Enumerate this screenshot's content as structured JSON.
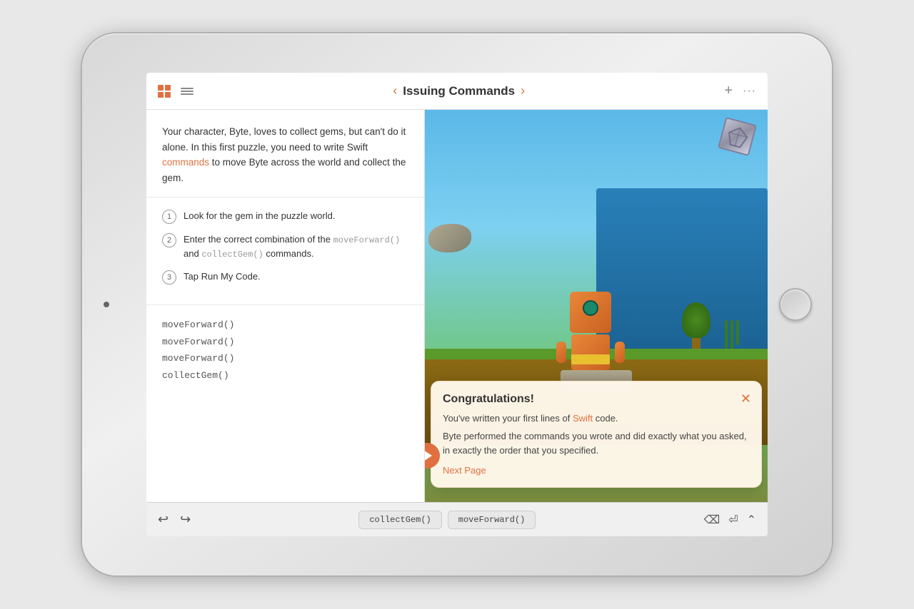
{
  "device": {
    "type": "iPad"
  },
  "toolbar": {
    "title": "Issuing Commands",
    "left_arrow": "‹",
    "right_arrow": "›",
    "plus_label": "+",
    "dots_label": "···"
  },
  "instructions": {
    "text": "Your character, Byte, loves to collect gems, but can't do it alone. In this first puzzle, you need to write Swift",
    "highlight_word": "commands",
    "text_after": "to move Byte across the world and collect the gem."
  },
  "steps": [
    {
      "number": "1",
      "text": "Look for the gem in the puzzle world."
    },
    {
      "number": "2",
      "text_before": "Enter the correct combination of the",
      "code1": "moveForward()",
      "text_middle": "and",
      "code2": "collectGem()",
      "text_after": "commands."
    },
    {
      "number": "3",
      "text": "Tap Run My Code."
    }
  ],
  "code_lines": [
    "moveForward()",
    "moveForward()",
    "moveForward()",
    "collectGem()"
  ],
  "bottom_toolbar": {
    "undo_label": "↩",
    "redo_label": "↪",
    "code_button1": "collectGem()",
    "code_button2": "moveForward()",
    "backspace_label": "⌫",
    "return_label": "⏎",
    "chevron_label": "⌃"
  },
  "congrats": {
    "title": "Congratulations!",
    "line1_before": "You've written your first lines of",
    "line1_highlight": "Swift",
    "line1_after": "code.",
    "line2": "Byte performed the commands you wrote and did exactly what you asked, in exactly the order that you specified.",
    "next_page_label": "Next Page",
    "close_label": "✕"
  }
}
